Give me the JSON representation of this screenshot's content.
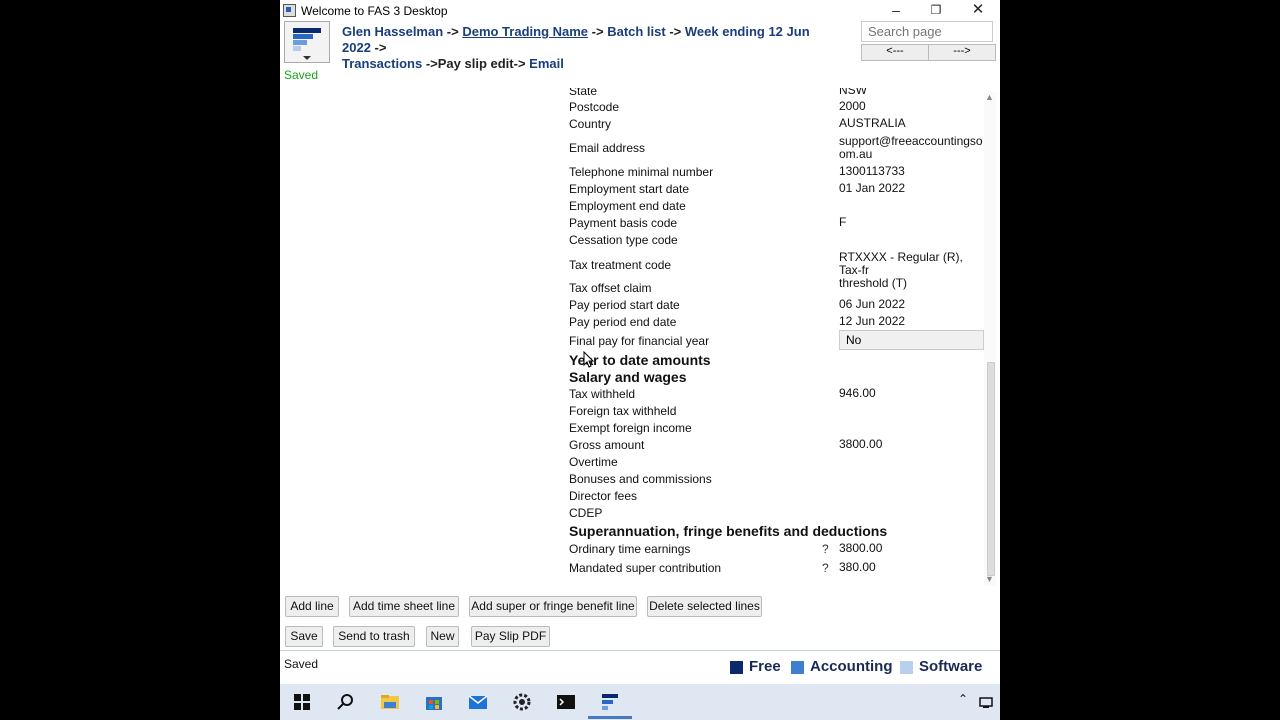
{
  "window": {
    "title": "Welcome to FAS 3 Desktop"
  },
  "breadcrumb": {
    "user": "Glen Hasselman",
    "arrow": "->",
    "company": "Demo Trading Name",
    "batch_list": "Batch list",
    "week": "Week ending 12 Jun 2022",
    "transactions": "Transactions",
    "arrow_nospace": "->",
    "payslip": "Pay slip edit",
    "email": "Email"
  },
  "search": {
    "placeholder": "Search page",
    "back_label": "<---",
    "forward_label": "--->"
  },
  "status": {
    "top": "Saved",
    "bottom": "Saved"
  },
  "fields": [
    {
      "label": "State",
      "value": "NSW"
    },
    {
      "label": "Postcode",
      "value": "2000"
    },
    {
      "label": "Country",
      "value": "AUSTRALIA"
    },
    {
      "label": "Email address",
      "value": "support@freeaccountingsoftw\nom.au"
    },
    {
      "label": "Telephone minimal number",
      "value": "1300113733"
    },
    {
      "label": "Employment start date",
      "value": "01 Jan 2022"
    },
    {
      "label": "Employment end date",
      "value": ""
    },
    {
      "label": "Payment basis code",
      "value": "F"
    },
    {
      "label": "Cessation type code",
      "value": ""
    },
    {
      "label": "Tax treatment code",
      "value": "RTXXXX - Regular (R), Tax-fr\nthreshold (T)"
    },
    {
      "label": "Tax offset claim",
      "value": ""
    },
    {
      "label": "Pay period start date",
      "value": "06 Jun 2022"
    },
    {
      "label": "Pay period end date",
      "value": "12 Jun 2022"
    },
    {
      "label": "Final pay for financial year",
      "value": "No"
    }
  ],
  "headings": {
    "ytd": "Year to date amounts",
    "salary": "Salary and wages",
    "super": "Superannuation, fringe benefits and deductions"
  },
  "salary_rows": [
    {
      "label": "Tax withheld",
      "value": "946.00"
    },
    {
      "label": "Foreign tax withheld",
      "value": ""
    },
    {
      "label": "Exempt foreign income",
      "value": ""
    },
    {
      "label": "Gross amount",
      "value": "3800.00"
    },
    {
      "label": "Overtime",
      "value": ""
    },
    {
      "label": "Bonuses and commissions",
      "value": ""
    },
    {
      "label": "Director fees",
      "value": ""
    },
    {
      "label": "CDEP",
      "value": ""
    }
  ],
  "super_rows": [
    {
      "label": "Ordinary time earnings",
      "help": "?",
      "value": "3800.00"
    },
    {
      "label": "Mandated super contribution",
      "help": "?",
      "value": "380.00"
    }
  ],
  "buttons": {
    "add_line": "Add line",
    "add_timesheet": "Add time sheet line",
    "add_super": "Add super or fringe benefit line",
    "delete_selected": "Delete selected lines",
    "save": "Save",
    "send_trash": "Send to trash",
    "new": "New",
    "payslip_pdf": "Pay Slip PDF"
  },
  "brand": {
    "free": "Free",
    "accounting": "Accounting",
    "software": "Software",
    "colors": {
      "free": "#0b2a6b",
      "accounting": "#3f7fcf",
      "software": "#b9cfee"
    }
  },
  "taskbar": {
    "icons": [
      "windows-start-icon",
      "search-icon",
      "file-explorer-icon",
      "store-icon",
      "mail-icon",
      "settings-icon",
      "terminal-icon",
      "fas-app-icon"
    ]
  }
}
